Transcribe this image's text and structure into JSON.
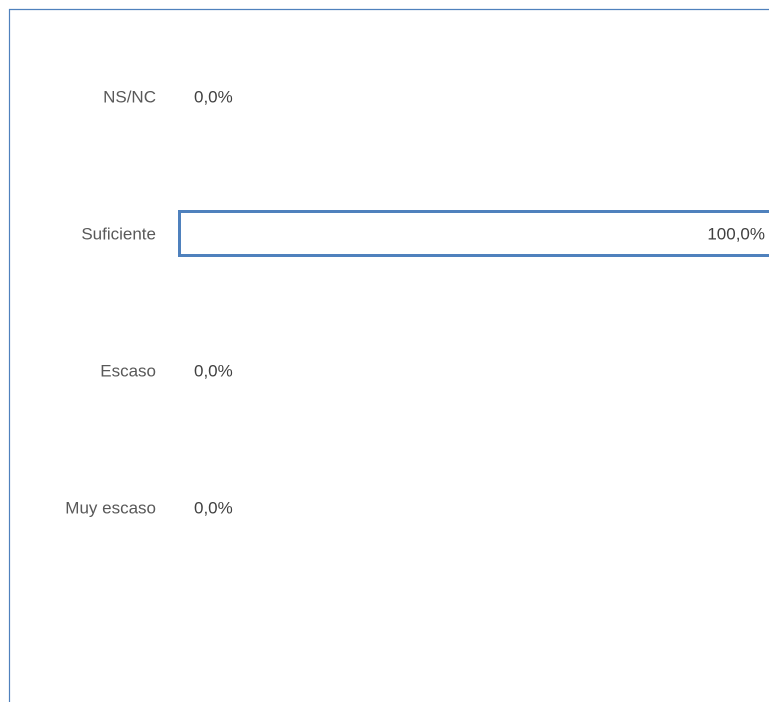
{
  "chart_data": {
    "type": "bar",
    "orientation": "horizontal",
    "categories": [
      "NS/NC",
      "Suficiente",
      "Escaso",
      "Muy escaso"
    ],
    "values": [
      0.0,
      100.0,
      0.0,
      0.0
    ],
    "labels": [
      "0,0%",
      "100,0%",
      "0,0%",
      "0,0%"
    ],
    "xlim": [
      0,
      100
    ],
    "unit": "%",
    "grid": false,
    "legend": "none",
    "colors": {
      "bar_fill": "#ffffff",
      "bar_stroke": "#4f81bd",
      "frame": "#4f81bd",
      "label_text": "#595959",
      "value_text": "#404040"
    }
  }
}
